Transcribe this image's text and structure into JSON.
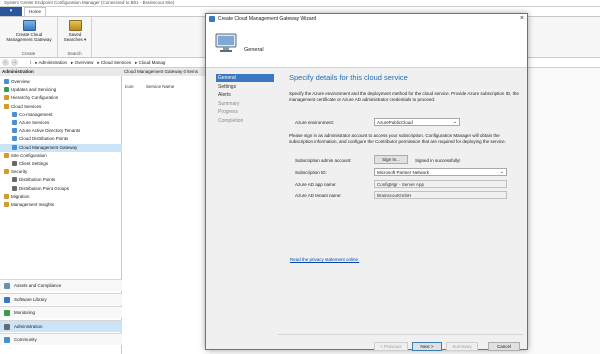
{
  "console": {
    "title": "System Center Endpoint Configuration Manager (Connected to B01 - Brainscout Site)",
    "menu_label": "",
    "tab_home": "Home",
    "ribbon": {
      "create_label": "Create Cloud Management Gateway",
      "create_group": "Create",
      "saved_label": "Saved Searches",
      "search_group": "Search"
    },
    "breadcrumb": [
      "\\",
      "Administration",
      "Overview",
      "Cloud Services",
      "Cloud Manag"
    ],
    "nav_header": "Administration",
    "tree": [
      {
        "label": "Overview",
        "color": "#4a8fd6"
      },
      {
        "label": "Updates and Servicing",
        "color": "#3a9c4a"
      },
      {
        "label": "Hierarchy Configuration",
        "color": "#d69a2a"
      },
      {
        "label": "Cloud Services",
        "color": "#d69a2a"
      },
      {
        "label": "Co-management",
        "color": "#4a8fd6"
      },
      {
        "label": "Azure Services",
        "color": "#4a8fd6"
      },
      {
        "label": "Azure Active Directory Tenants",
        "color": "#4a8fd6"
      },
      {
        "label": "Cloud Distribution Points",
        "color": "#4a8fd6"
      },
      {
        "label": "Cloud Management Gateway",
        "color": "#4a8fd6"
      },
      {
        "label": "Site Configuration",
        "color": "#d69a2a"
      },
      {
        "label": "Client Settings",
        "color": "#6a6a6a"
      },
      {
        "label": "Security",
        "color": "#d69a2a"
      },
      {
        "label": "Distribution Points",
        "color": "#6a6a6a"
      },
      {
        "label": "Distribution Point Groups",
        "color": "#6a6a6a"
      },
      {
        "label": "Migration",
        "color": "#d69a2a"
      },
      {
        "label": "Management Insights",
        "color": "#d69a2a"
      }
    ],
    "workspaces": [
      {
        "label": "Assets and Compliance",
        "color": "#6a8fb5"
      },
      {
        "label": "Software Library",
        "color": "#3a78c2"
      },
      {
        "label": "Monitoring",
        "color": "#3a9c4a"
      },
      {
        "label": "Administration",
        "color": "#6a6a6a"
      },
      {
        "label": "Community",
        "color": "#4a8fd6"
      }
    ],
    "center_header": "Cloud Management Gateway 0 items",
    "columns": [
      "Icon",
      "Service Name"
    ]
  },
  "wizard": {
    "title": "Create Cloud Management Gateway Wizard",
    "header_label": "General",
    "steps": [
      {
        "label": "General",
        "state": "active"
      },
      {
        "label": "Settings",
        "state": "normal"
      },
      {
        "label": "Alerts",
        "state": "normal"
      },
      {
        "label": "Summary",
        "state": "disabled"
      },
      {
        "label": "Progress",
        "state": "disabled"
      },
      {
        "label": "Completion",
        "state": "disabled"
      }
    ],
    "heading": "Specify details for this cloud service",
    "intro": "Specify the Azure environment and the deployment method for the cloud service. Provide Azure subscription ID, the management certificate or Azure AD administrator credentials to proceed.",
    "env_label": "Azure environment:",
    "env_value": "AzurePublicCloud",
    "signin_text": "Please sign in as administrator account to access your subscription. Configuration Manager will obtain the subscription information, and configure the Contributor permission that are required for deploying the service.",
    "admin_label": "Subscription admin account:",
    "signin_button": "Sign In...",
    "signin_status": "Signed in successfully!",
    "sub_label": "Subscription ID:",
    "sub_value": "Microsoft Partner Network",
    "app_label": "Azure AD app name:",
    "app_value": "ConfigMgr - Server App",
    "tenant_label": "Azure AD tenant name:",
    "tenant_value": "BrainscoutGmbH",
    "privacy_link": "Read the privacy statement online.",
    "buttons": {
      "previous": "< Previous",
      "next": "Next >",
      "summary": "Summary",
      "cancel": "Cancel"
    }
  },
  "colors": {
    "accent": "#3b78c2",
    "heading": "#1f6bb3",
    "selection": "#cce4f7"
  }
}
